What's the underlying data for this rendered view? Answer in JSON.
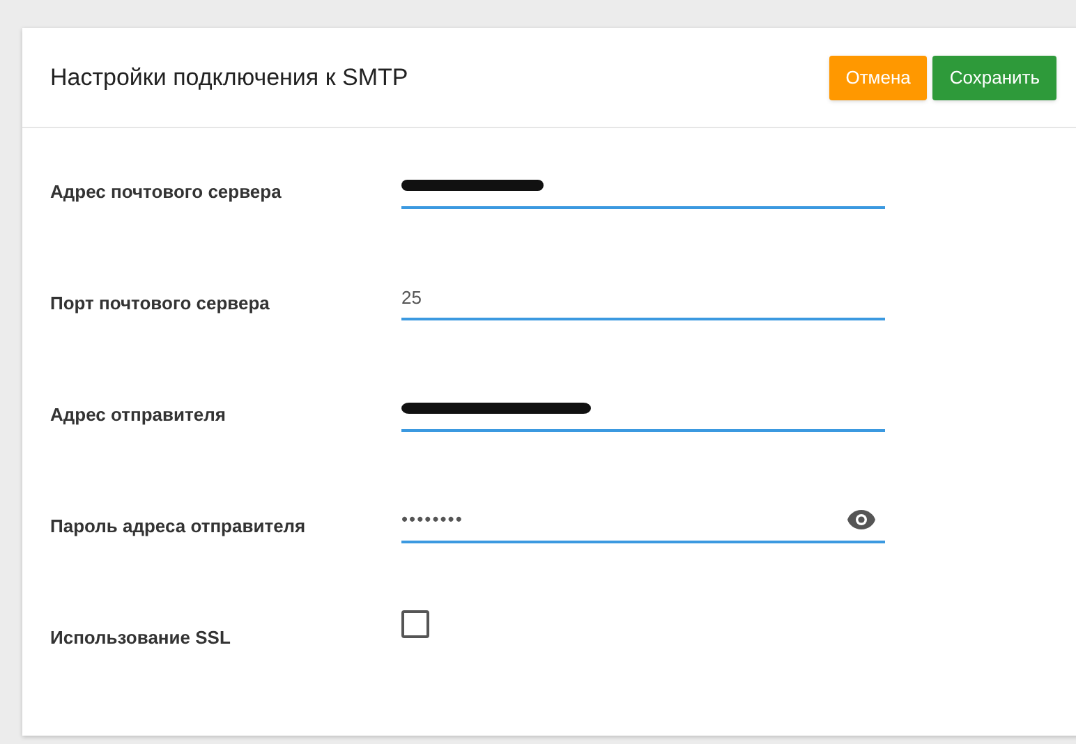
{
  "dialog": {
    "title": "Настройки подключения к SMTP",
    "buttons": [
      {
        "label": "Отмена",
        "kind": "cancel"
      },
      {
        "label": "Сохранить",
        "kind": "save"
      }
    ]
  },
  "fields": [
    {
      "label": "Адрес почтового сервера",
      "kind": "redacted"
    },
    {
      "label": "Порт почтового сервера",
      "kind": "text",
      "value": "25"
    },
    {
      "label": "Адрес отправителя",
      "kind": "redacted"
    },
    {
      "label": "Пароль адреса отправителя",
      "kind": "password",
      "value": "••••••••"
    },
    {
      "label": "Использование SSL",
      "kind": "checkbox",
      "checked": false
    }
  ]
}
